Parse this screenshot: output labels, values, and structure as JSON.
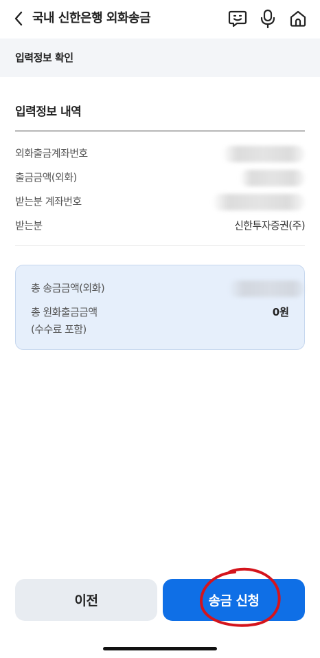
{
  "header": {
    "title": "국내 신한은행 외화송금",
    "icons": [
      "back-arrow-icon",
      "chatbot-icon",
      "microphone-icon",
      "home-icon"
    ]
  },
  "section_bar": {
    "title": "입력정보 확인"
  },
  "details": {
    "title": "입력정보 내역",
    "rows": [
      {
        "label": "외화출금계좌번호",
        "value": ""
      },
      {
        "label": "출금금액(외화)",
        "value": ""
      },
      {
        "label": "받는분 계좌번호",
        "value": ""
      },
      {
        "label": "받는분",
        "value": "신한투자증권(주)"
      }
    ]
  },
  "summary": {
    "total_foreign_label": "총 송금금액(외화)",
    "total_foreign_value": "",
    "total_krw_label": "총 원화출금금액",
    "total_krw_note": "(수수료 포함)",
    "total_krw_value": "0원"
  },
  "buttons": {
    "prev_label": "이전",
    "submit_label": "송금 신청"
  },
  "colors": {
    "primary": "#0f6fe6",
    "section_bg": "#f3f5f8",
    "summary_bg": "#e6effb",
    "annotation": "#d4141c"
  }
}
